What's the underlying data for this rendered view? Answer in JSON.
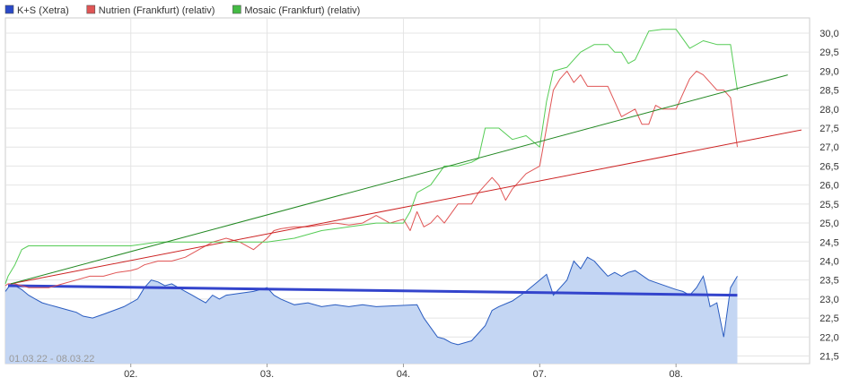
{
  "chart_data": {
    "type": "line",
    "legend": [
      {
        "label": "K+S (Xetra)",
        "color": "#2a49c8"
      },
      {
        "label": "Nutrien (Frankfurt) (relativ)",
        "color": "#e05555"
      },
      {
        "label": "Mosaic (Frankfurt) (relativ)",
        "color": "#44bb44"
      }
    ],
    "legend_position": "top-left",
    "range_label": "01.03.22 - 08.03.22",
    "x_ticks": [
      "02.",
      "03.",
      "04.",
      "07.",
      "08."
    ],
    "x_tick_pos": [
      1,
      2,
      3,
      4,
      5
    ],
    "xlim": [
      0.08,
      5.98
    ],
    "ylim": [
      21.3,
      30.4
    ],
    "y_ticks": [
      "21,5",
      "22,0",
      "22,5",
      "23,0",
      "23,5",
      "24,0",
      "24,5",
      "25,0",
      "25,5",
      "26,0",
      "26,5",
      "27,0",
      "27,5",
      "28,0",
      "28,5",
      "29,0",
      "29,5",
      "30,0"
    ],
    "y_tick_values": [
      21.5,
      22.0,
      22.5,
      23.0,
      23.5,
      24.0,
      24.5,
      25.0,
      25.5,
      26.0,
      26.5,
      27.0,
      27.5,
      28.0,
      28.5,
      29.0,
      29.5,
      30.0
    ],
    "grid": true,
    "y_axis_side": "right",
    "series": [
      {
        "name": "K+S (Xetra)",
        "type": "area",
        "color": "#2a5cc0",
        "fill": "#c4d6f3",
        "x": [
          0.08,
          0.12,
          0.15,
          0.2,
          0.25,
          0.3,
          0.35,
          0.4,
          0.45,
          0.5,
          0.55,
          0.6,
          0.65,
          0.72,
          0.8,
          0.95,
          1.05,
          1.1,
          1.15,
          1.2,
          1.25,
          1.3,
          1.35,
          1.4,
          1.45,
          1.5,
          1.55,
          1.6,
          1.65,
          1.7,
          1.8,
          1.9,
          2.0,
          2.05,
          2.1,
          2.2,
          2.3,
          2.4,
          2.5,
          2.6,
          2.7,
          2.8,
          3.1,
          3.15,
          3.2,
          3.25,
          3.3,
          3.35,
          3.4,
          3.5,
          3.6,
          3.65,
          3.7,
          3.8,
          3.9,
          4.0,
          4.05,
          4.1,
          4.15,
          4.2,
          4.25,
          4.3,
          4.35,
          4.4,
          4.45,
          4.5,
          4.55,
          4.6,
          4.65,
          4.7,
          4.8,
          5.0,
          5.05,
          5.1,
          5.15,
          5.2,
          5.22,
          5.25,
          5.3,
          5.35,
          5.4,
          5.45
        ],
        "y": [
          23.2,
          23.4,
          23.35,
          23.25,
          23.1,
          23.0,
          22.9,
          22.85,
          22.8,
          22.75,
          22.7,
          22.65,
          22.55,
          22.5,
          22.6,
          22.8,
          23.0,
          23.3,
          23.5,
          23.45,
          23.35,
          23.4,
          23.3,
          23.2,
          23.1,
          23.0,
          22.9,
          23.1,
          23.0,
          23.1,
          23.15,
          23.2,
          23.3,
          23.1,
          23.0,
          22.85,
          22.9,
          22.8,
          22.85,
          22.8,
          22.85,
          22.8,
          22.85,
          22.5,
          22.25,
          22.0,
          21.95,
          21.85,
          21.8,
          21.9,
          22.3,
          22.7,
          22.8,
          22.95,
          23.2,
          23.5,
          23.65,
          23.1,
          23.3,
          23.5,
          24.0,
          23.8,
          24.1,
          24.0,
          23.8,
          23.6,
          23.7,
          23.6,
          23.7,
          23.75,
          23.5,
          23.25,
          23.2,
          23.1,
          23.3,
          23.6,
          23.3,
          22.8,
          22.9,
          22.0,
          23.3,
          23.6
        ]
      },
      {
        "name": "K+S Trend",
        "type": "line",
        "color": "#3344cc",
        "x": [
          0.1,
          5.45
        ],
        "y": [
          23.35,
          23.1
        ]
      },
      {
        "name": "Nutrien (Frankfurt) (relativ)",
        "type": "line",
        "color": "#e05555",
        "x": [
          0.08,
          0.1,
          0.15,
          0.2,
          0.25,
          0.3,
          0.4,
          0.5,
          0.6,
          0.7,
          0.8,
          0.9,
          1.0,
          1.05,
          1.1,
          1.2,
          1.3,
          1.4,
          1.5,
          1.6,
          1.7,
          1.8,
          1.9,
          2.0,
          2.05,
          2.1,
          2.2,
          2.3,
          2.4,
          2.5,
          2.6,
          2.7,
          2.8,
          2.9,
          3.0,
          3.05,
          3.1,
          3.15,
          3.2,
          3.25,
          3.3,
          3.4,
          3.5,
          3.55,
          3.6,
          3.65,
          3.7,
          3.75,
          3.8,
          3.85,
          3.9,
          4.0,
          4.05,
          4.1,
          4.15,
          4.2,
          4.25,
          4.3,
          4.35,
          4.4,
          4.5,
          4.6,
          4.7,
          4.75,
          4.8,
          4.85,
          4.9,
          5.0,
          5.05,
          5.1,
          5.15,
          5.2,
          5.25,
          5.3,
          5.35,
          5.4,
          5.45
        ],
        "y": [
          23.35,
          23.4,
          23.4,
          23.35,
          23.3,
          23.3,
          23.3,
          23.4,
          23.5,
          23.6,
          23.6,
          23.7,
          23.75,
          23.8,
          23.9,
          24.0,
          24.0,
          24.1,
          24.3,
          24.5,
          24.6,
          24.5,
          24.3,
          24.6,
          24.8,
          24.85,
          24.9,
          24.9,
          24.95,
          25.0,
          24.95,
          25.0,
          25.2,
          25.0,
          25.1,
          24.8,
          25.3,
          24.9,
          25.0,
          25.2,
          25.0,
          25.5,
          25.5,
          25.8,
          26.0,
          26.2,
          26.0,
          25.6,
          25.9,
          26.1,
          26.3,
          26.5,
          27.5,
          28.5,
          28.8,
          29.0,
          28.7,
          28.9,
          28.6,
          28.6,
          28.6,
          27.8,
          28.0,
          27.6,
          27.6,
          28.1,
          28.0,
          28.0,
          28.4,
          28.8,
          29.0,
          28.9,
          28.7,
          28.5,
          28.5,
          28.3,
          27.0
        ]
      },
      {
        "name": "Nutrien Trend",
        "type": "line",
        "color": "#cc2222",
        "x": [
          0.12,
          5.92
        ],
        "y": [
          23.4,
          27.45
        ]
      },
      {
        "name": "Mosaic (Frankfurt) (relativ)",
        "type": "line",
        "color": "#55cc55",
        "x": [
          0.08,
          0.1,
          0.15,
          0.2,
          0.25,
          0.3,
          0.5,
          0.8,
          1.0,
          1.2,
          1.5,
          1.8,
          2.0,
          2.2,
          2.4,
          2.6,
          2.8,
          3.0,
          3.05,
          3.1,
          3.2,
          3.3,
          3.4,
          3.5,
          3.55,
          3.6,
          3.7,
          3.8,
          3.9,
          4.0,
          4.05,
          4.1,
          4.2,
          4.3,
          4.35,
          4.4,
          4.5,
          4.55,
          4.6,
          4.65,
          4.7,
          4.8,
          4.9,
          5.0,
          5.1,
          5.2,
          5.3,
          5.4,
          5.45
        ],
        "y": [
          23.4,
          23.6,
          23.9,
          24.3,
          24.4,
          24.4,
          24.4,
          24.4,
          24.4,
          24.5,
          24.5,
          24.5,
          24.5,
          24.6,
          24.8,
          24.9,
          25.0,
          25.0,
          25.3,
          25.8,
          26.0,
          26.5,
          26.5,
          26.6,
          26.7,
          27.5,
          27.5,
          27.2,
          27.3,
          27.0,
          28.2,
          29.0,
          29.1,
          29.5,
          29.6,
          29.7,
          29.7,
          29.5,
          29.5,
          29.2,
          29.3,
          30.05,
          30.1,
          30.1,
          29.6,
          29.8,
          29.7,
          29.7,
          28.5
        ]
      },
      {
        "name": "Mosaic Trend",
        "type": "line",
        "color": "#228822",
        "x": [
          0.12,
          5.82
        ],
        "y": [
          23.4,
          28.9
        ]
      }
    ]
  }
}
